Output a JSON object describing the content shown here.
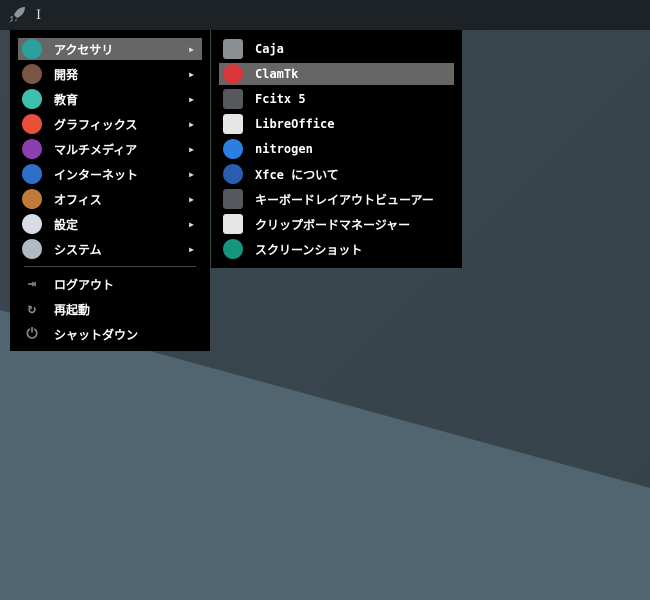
{
  "panel": {
    "cursor": "I"
  },
  "main_menu": {
    "categories": [
      {
        "label": "アクセサリ",
        "icon": "accessories-icon",
        "color": "#2aa19c"
      },
      {
        "label": "開発",
        "icon": "hammer-icon",
        "color": "#7a5546"
      },
      {
        "label": "教育",
        "icon": "education-icon",
        "color": "#3cc0b0"
      },
      {
        "label": "グラフィックス",
        "icon": "graphics-icon",
        "color": "#e8503a"
      },
      {
        "label": "マルチメディア",
        "icon": "multimedia-icon",
        "color": "#8c3fb0"
      },
      {
        "label": "インターネット",
        "icon": "internet-icon",
        "color": "#2d6fc9"
      },
      {
        "label": "オフィス",
        "icon": "briefcase-icon",
        "color": "#c07a3a"
      },
      {
        "label": "設定",
        "icon": "settings-icon",
        "color": "#d8dde3"
      },
      {
        "label": "システム",
        "icon": "system-gear-icon",
        "color": "#b0bac2"
      }
    ],
    "actions": [
      {
        "label": "ログアウト",
        "icon": "logout-icon"
      },
      {
        "label": "再起動",
        "icon": "restart-icon"
      },
      {
        "label": "シャットダウン",
        "icon": "power-icon"
      }
    ],
    "arrow": "▶"
  },
  "sub_menu": {
    "items": [
      {
        "label": "Caja",
        "icon": "file-manager-icon",
        "color": "#8a8f93"
      },
      {
        "label": "ClamTk",
        "icon": "clamtk-icon",
        "color": "#d8363a"
      },
      {
        "label": "Fcitx 5",
        "icon": "keyboard-icon",
        "color": "#55595d"
      },
      {
        "label": "LibreOffice",
        "icon": "document-icon",
        "color": "#e6e6e6"
      },
      {
        "label": "nitrogen",
        "icon": "nitrogen-icon",
        "color": "#2b7fe0"
      },
      {
        "label": "Xfce について",
        "icon": "xfce-icon",
        "color": "#2a5db0"
      },
      {
        "label": "キーボードレイアウトビューアー",
        "icon": "keyboard-icon",
        "color": "#55595d"
      },
      {
        "label": "クリップボードマネージャー",
        "icon": "clipboard-icon",
        "color": "#e6e6e6"
      },
      {
        "label": "スクリーンショット",
        "icon": "screenshot-icon",
        "color": "#14957e"
      }
    ]
  }
}
